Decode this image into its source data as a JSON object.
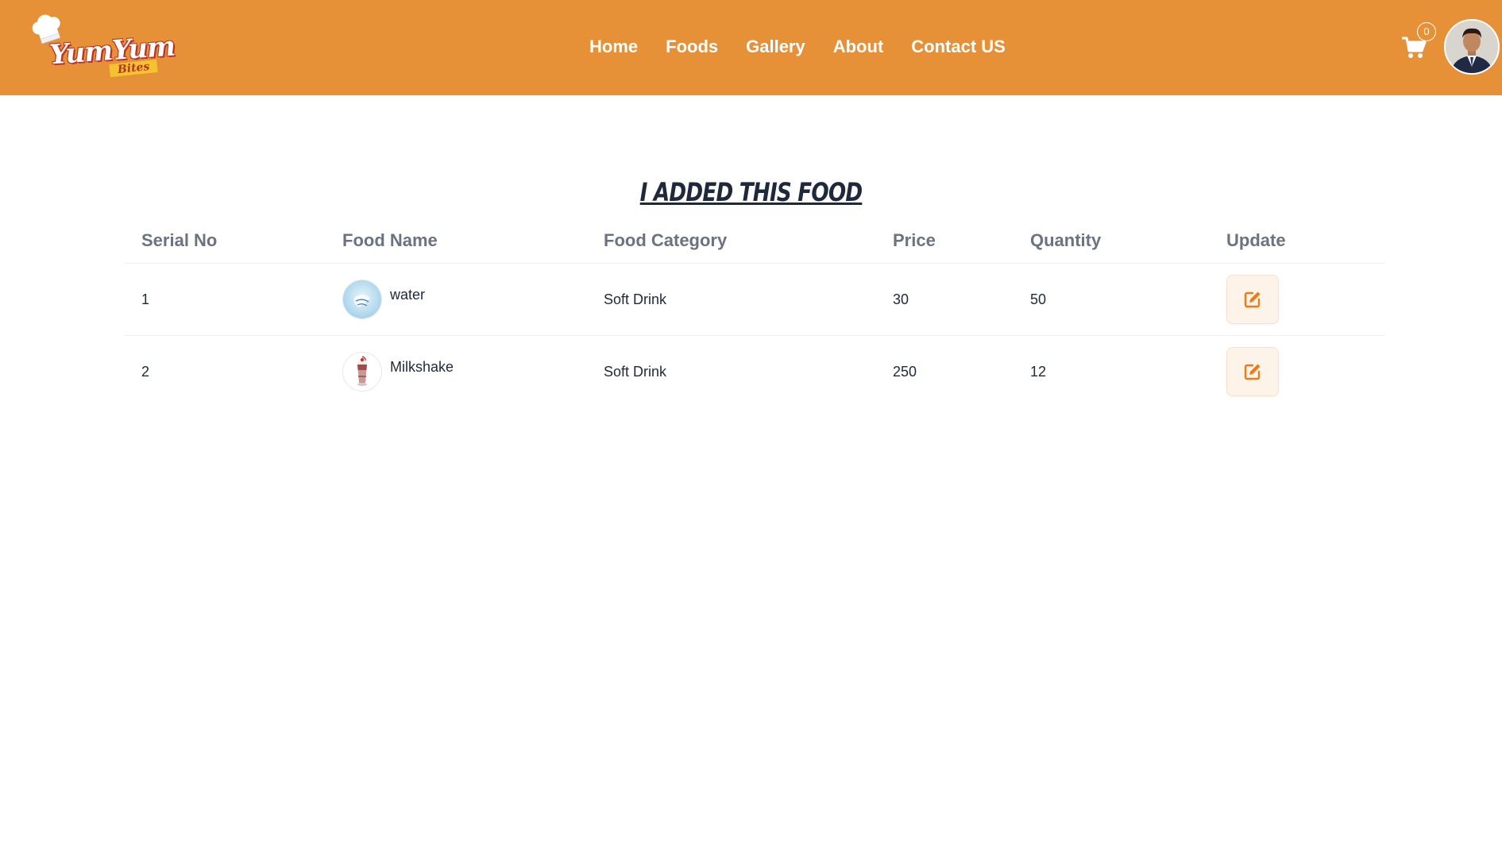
{
  "brand": {
    "name_line_1": "YumYum",
    "name_line_2": "Bites",
    "logo_icon": "chef-hat-icon"
  },
  "nav": {
    "links": [
      {
        "label": "Home"
      },
      {
        "label": "Foods"
      },
      {
        "label": "Gallery"
      },
      {
        "label": "About"
      },
      {
        "label": "Contact US"
      }
    ]
  },
  "cart": {
    "icon": "shopping-cart-icon",
    "count": "0"
  },
  "user": {
    "avatar_icon": "user-avatar"
  },
  "page": {
    "title": "I ADDED THIS FOOD"
  },
  "table": {
    "headers": [
      "Serial No",
      "Food Name",
      "Food Category",
      "Price",
      "Quantity",
      "Update"
    ],
    "rows": [
      {
        "serial": "1",
        "name": "water",
        "category": "Soft Drink",
        "price": "30",
        "quantity": "50",
        "thumb": "water-glass-image",
        "action_icon": "edit-icon"
      },
      {
        "serial": "2",
        "name": "Milkshake",
        "category": "Soft Drink",
        "price": "250",
        "quantity": "12",
        "thumb": "milkshake-image",
        "action_icon": "edit-icon"
      }
    ]
  },
  "colors": {
    "header_bg": "#e69138",
    "accent": "#f07b16",
    "button_bg": "#fef3e8"
  }
}
